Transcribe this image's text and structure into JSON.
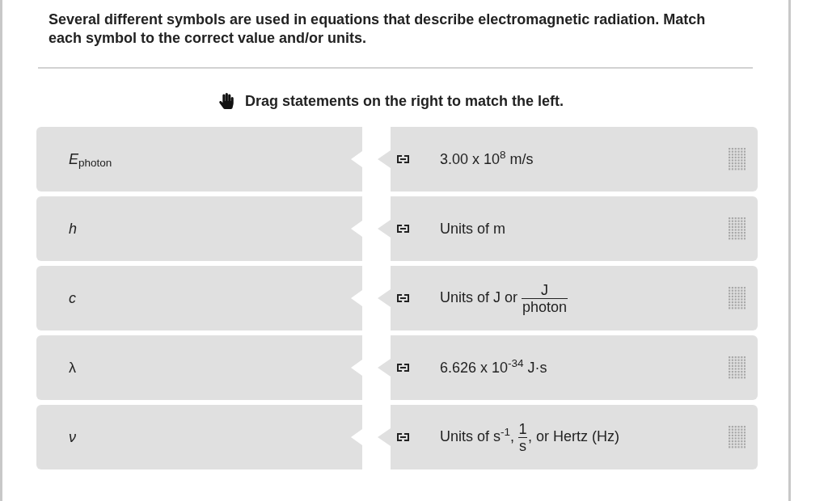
{
  "question": {
    "text": "Several different symbols are used in equations that describe electromagnetic radiation. Match each symbol to the correct value and/or units."
  },
  "instruction": {
    "text": "Drag statements on the right to match the left."
  },
  "symbols": [
    {
      "text": "*E*$_{photon}$",
      "italic": false
    },
    {
      "text": "h",
      "italic": true
    },
    {
      "text": "c",
      "italic": true
    },
    {
      "text": "λ",
      "italic": false
    },
    {
      "text": "ν",
      "italic": true
    }
  ],
  "statements": [
    {
      "parts": [
        {
          "kind": "text",
          "text": "3.00 x 10$^{8}$ m/s"
        }
      ]
    },
    {
      "parts": [
        {
          "kind": "text",
          "text": "Units of m"
        }
      ]
    },
    {
      "parts": [
        {
          "kind": "text",
          "text": "Units of J or"
        },
        {
          "kind": "fraction",
          "numerator": "J",
          "denominator": "photon"
        }
      ]
    },
    {
      "parts": [
        {
          "kind": "text",
          "text": "6.626 x 10$^{-34}$ J·s"
        }
      ]
    },
    {
      "parts": [
        {
          "kind": "text",
          "text": "Units of s$^{-1}$,"
        },
        {
          "kind": "fraction",
          "numerator": "1",
          "denominator": "s"
        },
        {
          "kind": "text",
          "text": ", or Hertz (Hz)"
        }
      ]
    }
  ]
}
